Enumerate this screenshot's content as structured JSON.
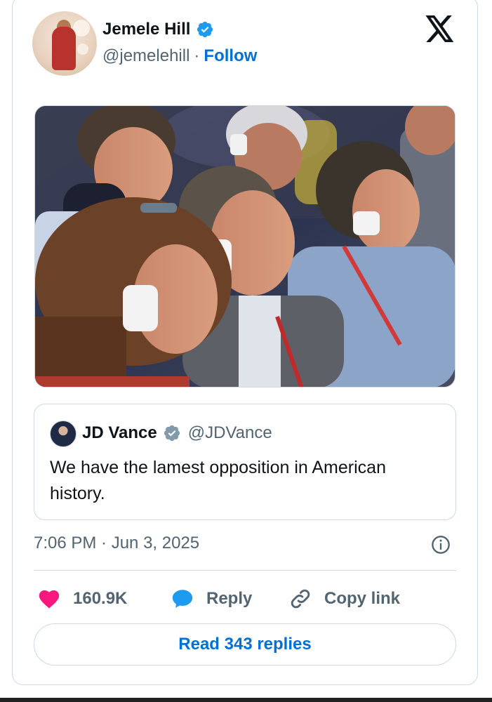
{
  "author": {
    "name": "Jemele Hill",
    "handle": "@jemelehill",
    "separator": "·",
    "follow_label": "Follow"
  },
  "icons": {
    "verified": "verified-badge-icon",
    "x_logo": "x-logo-icon",
    "info": "info-icon",
    "like": "heart-icon",
    "reply": "speech-bubble-icon",
    "copy": "link-icon"
  },
  "colors": {
    "accent": "#006fd6",
    "verified_blue": "#1d9bf0",
    "verified_gray": "#829aab",
    "like_pink": "#f91880",
    "text_secondary": "#536471",
    "border": "#cfd9de"
  },
  "quoted": {
    "name": "JD Vance",
    "handle": "@JDVance",
    "text": "We have the lamest opposition in American history."
  },
  "timestamp": "7:06 PM · Jun 3, 2025",
  "actions": {
    "like_count": "160.9K",
    "reply_label": "Reply",
    "copy_label": "Copy link"
  },
  "read_replies_label": "Read 343 replies"
}
